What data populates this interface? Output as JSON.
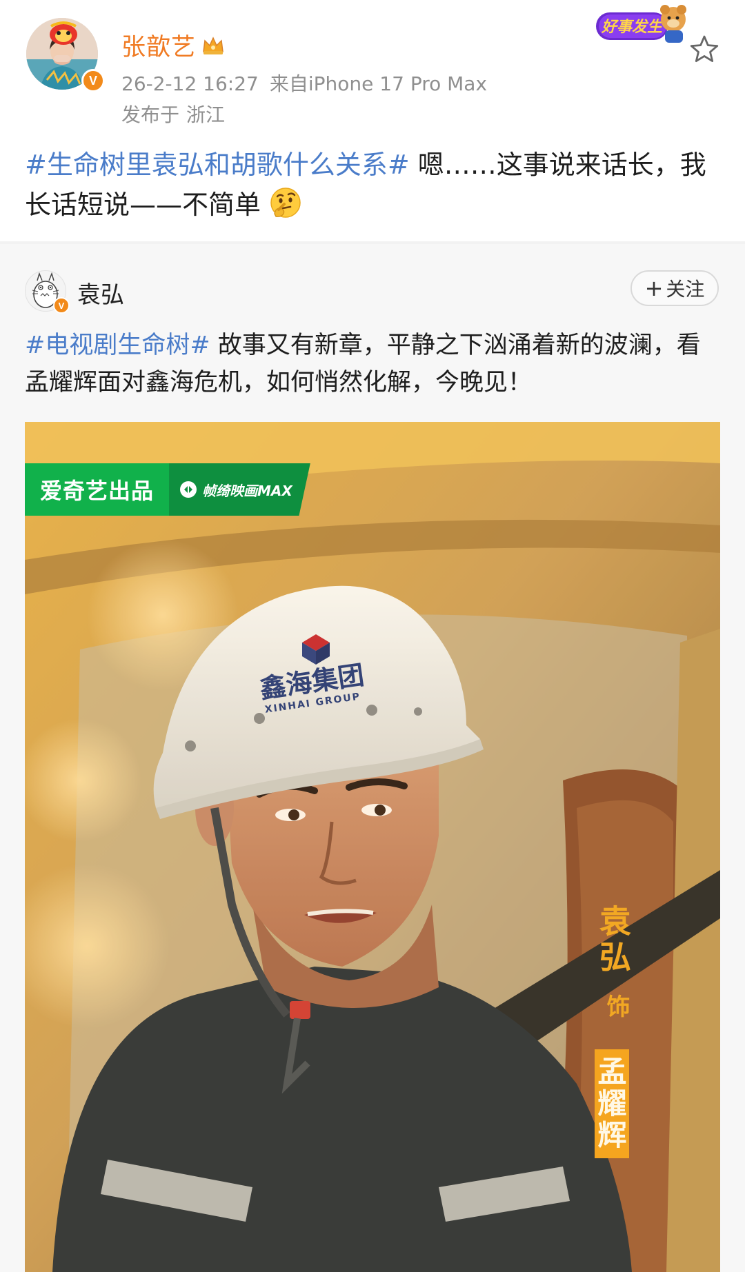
{
  "header": {
    "username": "张歆艺",
    "timestamp": "26-2-12 16:27",
    "source": "来自iPhone 17 Pro Max",
    "location_prefix": "发布于",
    "location": "浙江",
    "verified_mark": "V",
    "event_badge_text": "好事发生"
  },
  "post": {
    "hashtag": "#生命树里袁弘和胡歌什么关系#",
    "body": " 嗯……这事说来话长，我长话短说——不简单"
  },
  "repost": {
    "author": "袁弘",
    "verified_mark": "V",
    "follow_plus": "+",
    "follow_label": "关注",
    "hashtag": "#电视剧生命树#",
    "body": " 故事又有新章，平静之下汹涌着新的波澜，看孟耀辉面对鑫海危机，如何悄然化解，今晚见！"
  },
  "poster": {
    "brand_primary": "爱奇艺出品",
    "brand_secondary": "帧绮映画MAX",
    "helmet_text": "鑫海集团",
    "helmet_subtext": "XINHAI GROUP",
    "credit_actor": "袁弘",
    "credit_connector": "饰",
    "credit_role": "孟耀辉"
  },
  "colors": {
    "username": "#f07b24",
    "hashtag": "#4a7cc9",
    "meta": "#8f8f8f",
    "verified": "#f28a1a",
    "brand_green": "#11b14b",
    "credit_gold": "#f2a823"
  },
  "icons": {
    "crown": "crown-icon",
    "star": "star-icon",
    "emoji": "thinking-face-icon",
    "verified": "verified-badge-icon"
  }
}
